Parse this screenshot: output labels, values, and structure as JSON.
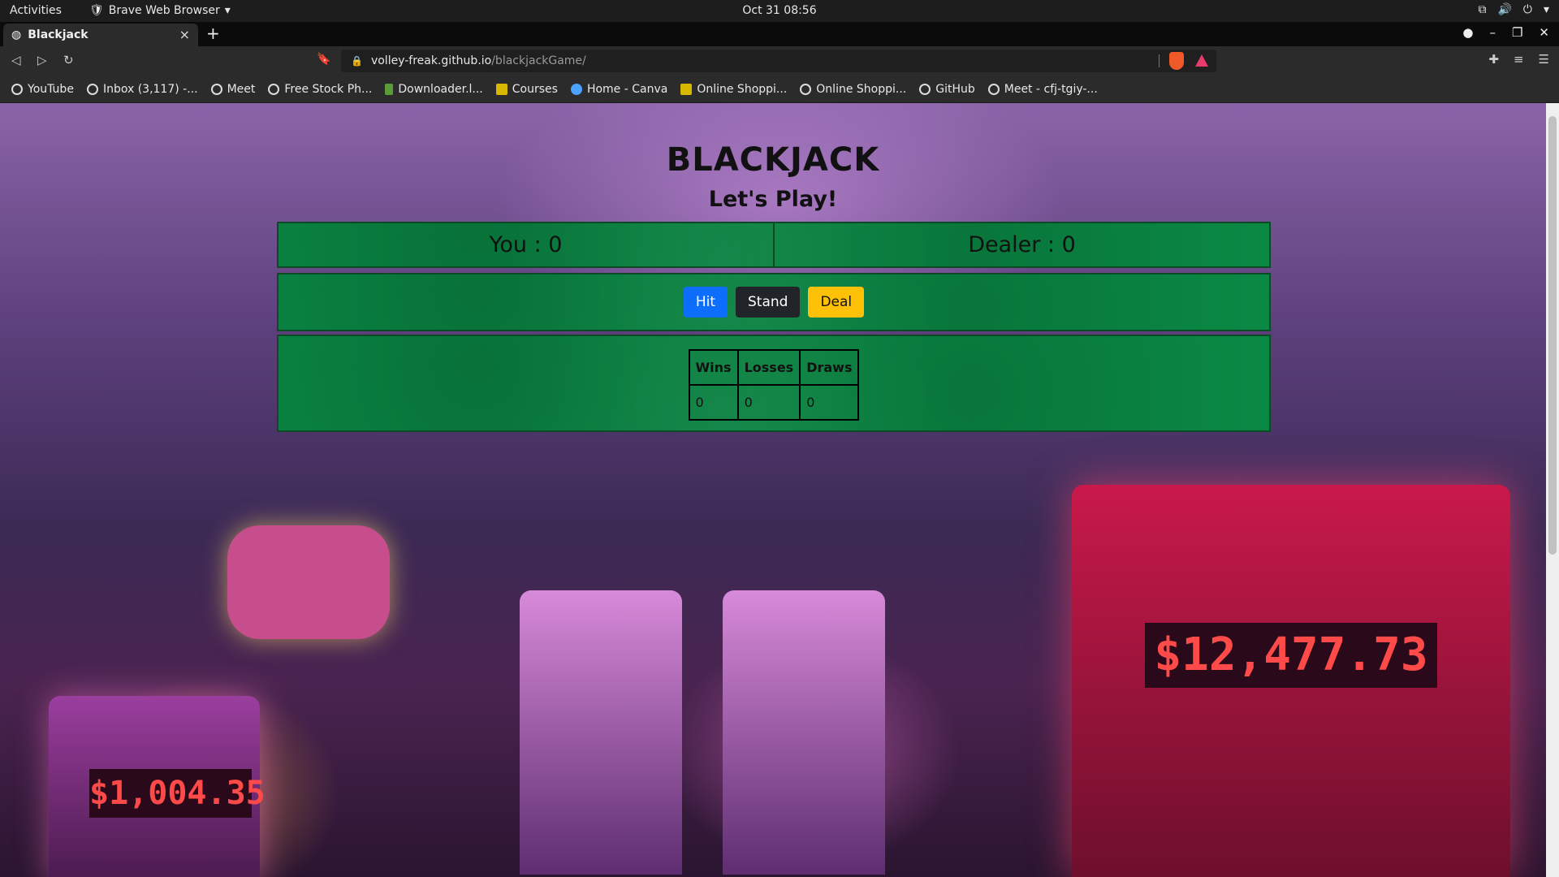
{
  "topbar": {
    "activities": "Activities",
    "app_name": "Brave Web Browser",
    "clock": "Oct 31  08:56"
  },
  "tab": {
    "title": "Blackjack",
    "close": "×",
    "new_tab": "+"
  },
  "address": {
    "host": "volley-freak.github.io",
    "path": "/blackjackGame/"
  },
  "bookmarks": [
    {
      "label": "YouTube"
    },
    {
      "label": "Inbox (3,117) -..."
    },
    {
      "label": "Meet"
    },
    {
      "label": "Free Stock Ph..."
    },
    {
      "label": "Downloader.l..."
    },
    {
      "label": "Courses"
    },
    {
      "label": "Home - Canva"
    },
    {
      "label": "Online Shoppi..."
    },
    {
      "label": "Online Shoppi..."
    },
    {
      "label": "GitHub"
    },
    {
      "label": "Meet - cfj-tgiy-..."
    }
  ],
  "game": {
    "title": "BLACKJACK",
    "subtitle": "Let's Play!",
    "you_label": "You : 0",
    "dealer_label": "Dealer : 0",
    "buttons": {
      "hit": "Hit",
      "stand": "Stand",
      "deal": "Deal"
    },
    "stats": {
      "headers": [
        "Wins",
        "Losses",
        "Draws"
      ],
      "values": [
        "0",
        "0",
        "0"
      ]
    }
  },
  "background": {
    "machine_left_display": "$1,004.35",
    "machine_right_display": "$12,477.73"
  },
  "colors": {
    "felt": "#0a8a45",
    "hit": "#0d6efd",
    "stand": "#212529",
    "deal": "#ffc107"
  }
}
